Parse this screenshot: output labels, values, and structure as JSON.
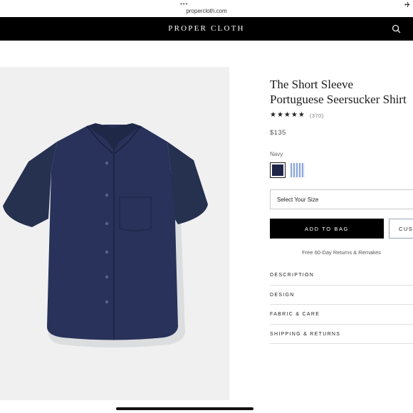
{
  "browser": {
    "url": "propercloth.com",
    "icons": {
      "menu": "three-dots",
      "status": "airplane-icon"
    }
  },
  "header": {
    "brand": "PROPER CLOTH",
    "search_icon": "search-icon"
  },
  "product": {
    "image": {
      "name": "navy-short-sleeve-shirt",
      "background": "#f0f0f1",
      "shirt_color": "#26304f"
    },
    "title": "The Short Sleeve Portuguese Seersucker Shirt",
    "stars": "★★★★★",
    "rating": 4.5,
    "reviews": "(370)",
    "price": "$135",
    "color_label": "Navy",
    "swatches": [
      {
        "name": "navy",
        "color": "#1e2548",
        "selected": true
      },
      {
        "name": "light-blue-stripe",
        "color": "#8fa8d9",
        "selected": false
      }
    ],
    "size_select": "Select Your Size",
    "add_to_bag": "ADD TO BAG",
    "custom_button": "CUST",
    "returns_note": "Free 60-Day Returns & Remakes",
    "accordion": [
      {
        "label": "DESCRIPTION"
      },
      {
        "label": "DESIGN"
      },
      {
        "label": "FABRIC & CARE"
      },
      {
        "label": "SHIPPING & RETURNS"
      }
    ]
  },
  "colors": {
    "header_bg": "#000000",
    "accent": "#000000",
    "text": "#1a1a1a"
  }
}
